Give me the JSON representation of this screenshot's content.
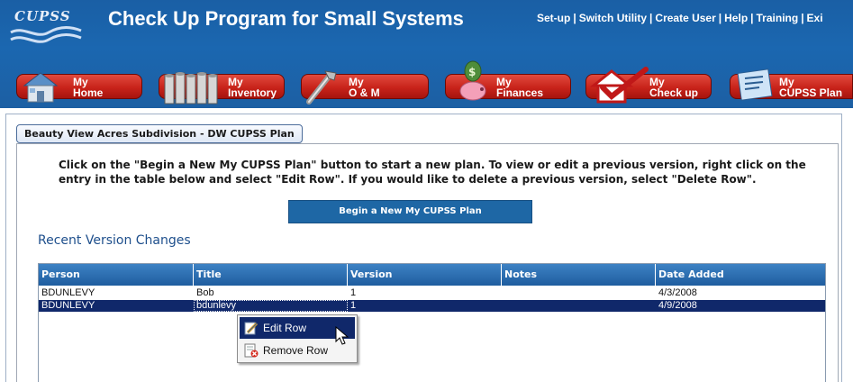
{
  "app": {
    "logo_text": "CUPSS",
    "title": "Check Up Program for Small Systems",
    "top_links": [
      "Set-up",
      "Switch Utility",
      "Create User",
      "Help",
      "Training",
      "Exi"
    ]
  },
  "nav": [
    {
      "line1": "My",
      "line2": "Home",
      "icon": "house-icon"
    },
    {
      "line1": "My",
      "line2": "Inventory",
      "icon": "pipes-inventory-icon"
    },
    {
      "line1": "My",
      "line2": "O & M",
      "icon": "wrench-icon"
    },
    {
      "line1": "My",
      "line2": "Finances",
      "icon": "piggy-bank-icon"
    },
    {
      "line1": "My",
      "line2": "Check up",
      "icon": "checkmark-house-icon"
    },
    {
      "line1": "My",
      "line2": "CUPSS Plan",
      "icon": "plan-document-icon"
    }
  ],
  "plan": {
    "tab_title": "Beauty View Acres Subdivision - DW CUPSS Plan",
    "instructions": "Click on the \"Begin a New My CUPSS Plan\" button to start a new plan.  To view or edit a previous version, right click on the entry in the table below and select \"Edit Row\".  If you would like to delete a previous version, select \"Delete Row\".",
    "begin_button": "Begin a New My CUPSS Plan",
    "section_title": "Recent Version Changes"
  },
  "grid": {
    "columns": [
      "Person",
      "Title",
      "Version",
      "Notes",
      "Date Added"
    ],
    "rows": [
      {
        "person": "BDUNLEVY",
        "title": "Bob",
        "version": "1",
        "notes": "",
        "date_added": "4/3/2008",
        "selected": false
      },
      {
        "person": "BDUNLEVY",
        "title": "bdunlevy",
        "version": "1",
        "notes": "",
        "date_added": "4/9/2008",
        "selected": true
      }
    ]
  },
  "context_menu": {
    "items": [
      {
        "label": "Edit Row",
        "icon": "edit-pencil-icon",
        "hover": true
      },
      {
        "label": "Remove Row",
        "icon": "remove-document-icon",
        "hover": false
      }
    ]
  },
  "colors": {
    "header_blue": "#1b67b0",
    "nav_red": "#c8231a",
    "button_blue": "#1e67a5",
    "selection_navy": "#10286a",
    "section_title": "#1e4f8c"
  }
}
